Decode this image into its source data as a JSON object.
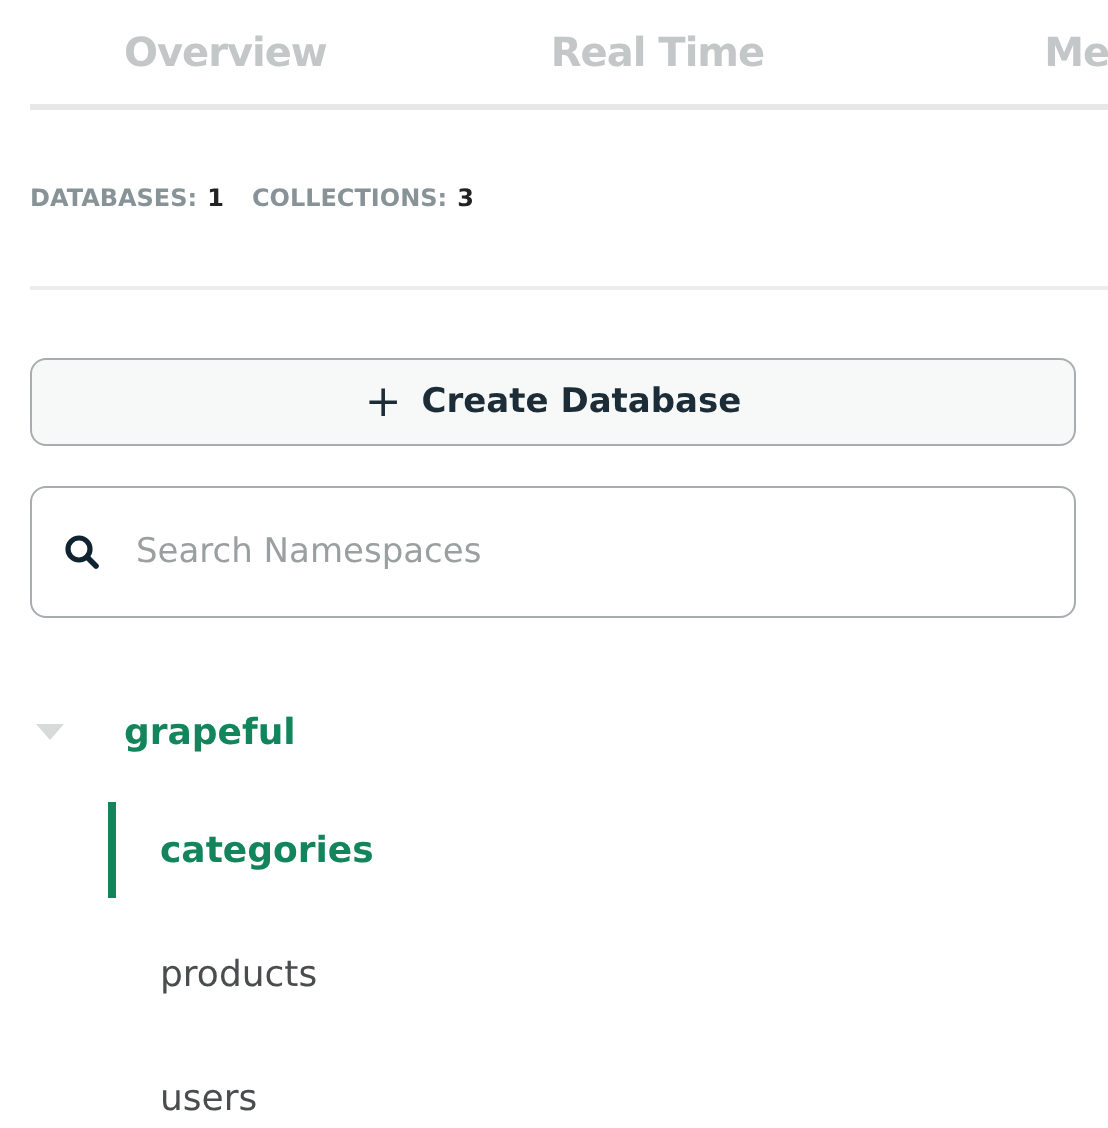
{
  "tabs": [
    {
      "label": "Overview",
      "selected": false
    },
    {
      "label": "Real Time",
      "selected": false
    },
    {
      "label": "Me",
      "selected": false
    }
  ],
  "stats": [
    {
      "label": "DATABASES:",
      "value": "1"
    },
    {
      "label": "COLLECTIONS:",
      "value": "3"
    }
  ],
  "create_button": {
    "label": "Create Database",
    "icon": "+"
  },
  "search": {
    "placeholder": "Search Namespaces"
  },
  "tree": [
    {
      "label": "grapeful",
      "expanded": true,
      "children": [
        {
          "label": "categories",
          "selected": true
        },
        {
          "label": "products",
          "selected": false
        },
        {
          "label": "users",
          "selected": false
        }
      ]
    }
  ]
}
